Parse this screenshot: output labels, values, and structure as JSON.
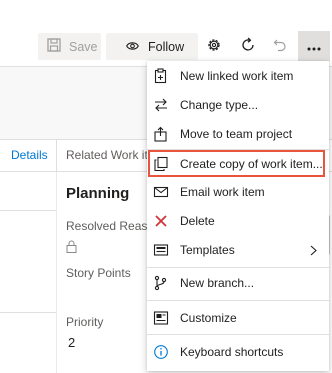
{
  "toolbar": {
    "save_label": "Save",
    "follow_label": "Follow",
    "icons": [
      "save-icon",
      "eye-icon",
      "gear-icon",
      "refresh-icon",
      "undo-icon",
      "more-icon"
    ]
  },
  "form": {
    "tab_details": "Details",
    "tab_related": "Related Work it",
    "section_title": "Planning",
    "resolved_reason_label": "Resolved Reaso",
    "story_points_label": "Story Points",
    "priority_label": "Priority",
    "priority_value": "2"
  },
  "menu": {
    "items": [
      {
        "label": "New linked work item",
        "icon": "clipboard-link-icon"
      },
      {
        "label": "Change type...",
        "icon": "arrows-swap-icon"
      },
      {
        "label": "Move to team project",
        "icon": "clipboard-move-icon"
      },
      {
        "label": "Create copy of work item...",
        "icon": "copy-icon",
        "highlighted": true
      },
      {
        "label": "Email work item",
        "icon": "mail-icon"
      },
      {
        "label": "Delete",
        "icon": "delete-x-icon"
      },
      {
        "label": "Templates",
        "icon": "template-icon",
        "submenu": true
      },
      {
        "label": "New branch...",
        "icon": "branch-icon"
      },
      {
        "label": "Customize",
        "icon": "customize-icon"
      },
      {
        "label": "Keyboard shortcuts",
        "icon": "info-icon"
      }
    ]
  },
  "colors": {
    "accent": "#0078d4",
    "delete_red": "#d13438",
    "highlight_border": "#e8543c"
  }
}
